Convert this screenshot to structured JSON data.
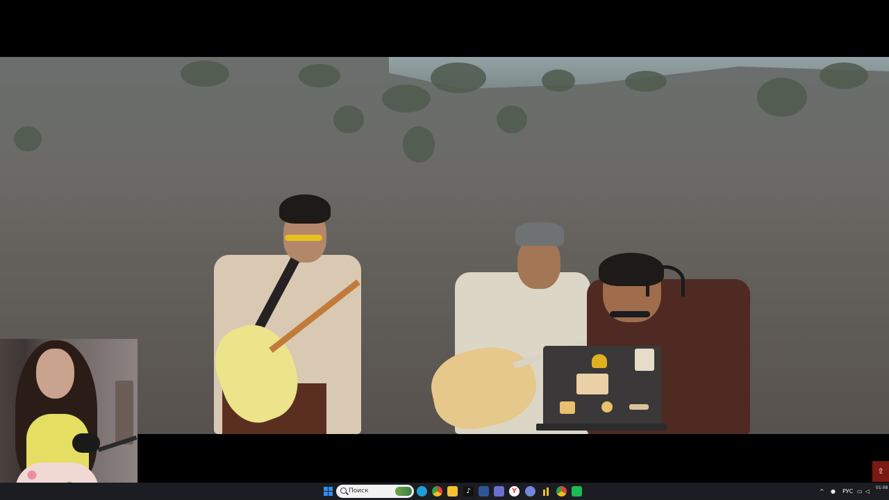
{
  "search": {
    "placeholder": "Поиск"
  },
  "taskbar": {
    "language": "РУС",
    "time": "01:08",
    "colors": {
      "background": "#1c1d22",
      "windows": "#2f8ff0",
      "edge": "#1f9fd6",
      "chrome": "#e0c020",
      "explorer": "#f2c232",
      "telegram": "#2aa3dd",
      "teams": "#6b6fd0",
      "yandex": "#ff3333"
    },
    "icons": [
      "windows-start-icon",
      "search-icon",
      "edge-icon",
      "chrome-icon",
      "file-explorer-icon",
      "tiktok-icon",
      "app-icon",
      "teams-icon",
      "yandex-icon",
      "discord-icon",
      "stats-icon",
      "chrome-alt-icon",
      "spotify-icon"
    ]
  },
  "tray": {
    "icons": [
      "chevron-up-icon",
      "microphone-icon",
      "network-icon",
      "volume-icon",
      "notification-icon"
    ]
  },
  "notif": {
    "icon": "upload-icon"
  }
}
